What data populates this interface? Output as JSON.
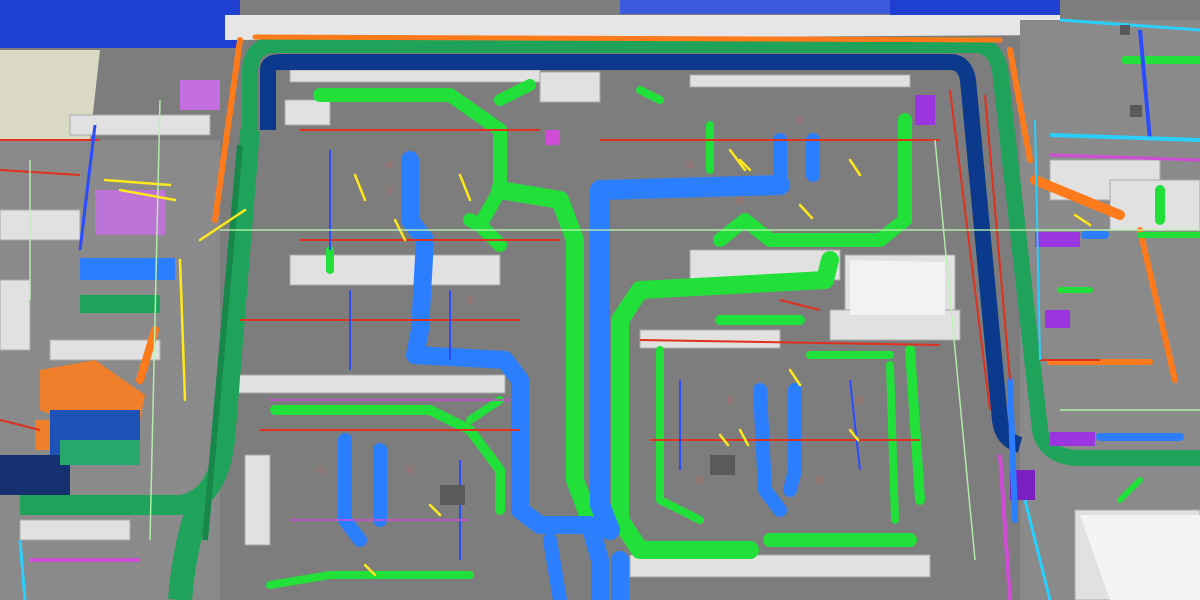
{
  "image": {
    "subject": "3d-bim-mep-coordination-model",
    "colors": {
      "floor": "#7d7d7d",
      "wall_top": "#e6e6e6",
      "wall_side": "#b4b4b4",
      "sky": "#1f3fd0",
      "supply_duct": "#22e03a",
      "return_duct": "#2b7fff",
      "perimeter_duct": "#1fa35a",
      "perimeter_duct_dark": "#0b3a8c",
      "hot_pipe": "#ff7a1a",
      "fire_pipe": "#e0301e",
      "plumbing_pipe": "#2b4bff",
      "electrical": "#ffe81a",
      "misc_pipe": "#d04bd6",
      "cyan_pipe": "#29d0ff"
    }
  }
}
